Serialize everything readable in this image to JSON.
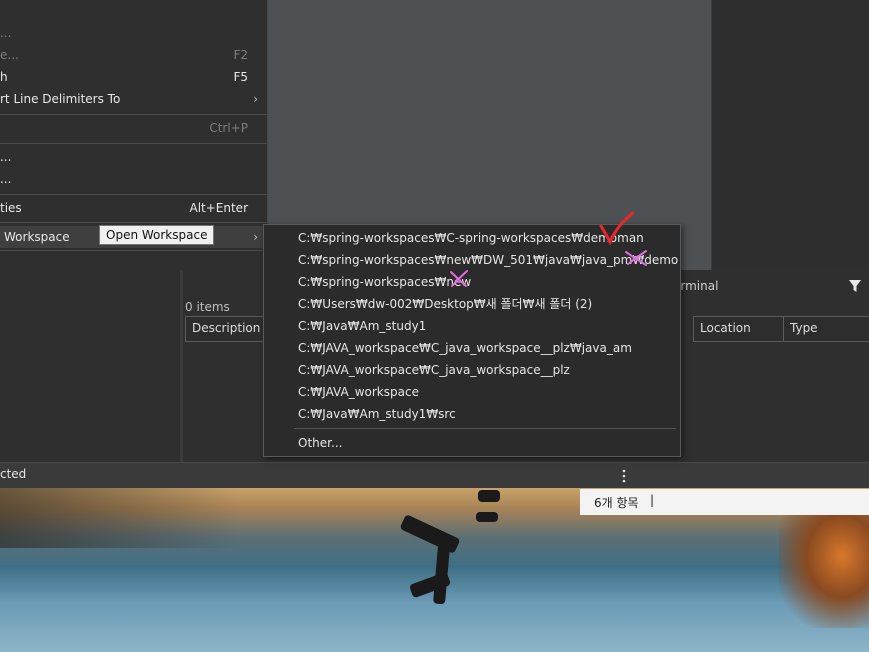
{
  "file_menu": {
    "items": [
      {
        "label": "...",
        "accelerator": "",
        "disabled": true
      },
      {
        "label": "e...",
        "accelerator": "F2",
        "disabled": true
      },
      {
        "label": "h",
        "accelerator": "F5",
        "disabled": false
      },
      {
        "label": "rt Line Delimiters To",
        "accelerator": "",
        "disabled": false
      },
      {
        "label": "",
        "accelerator": "Ctrl+P",
        "disabled": true
      },
      {
        "label": "...",
        "accelerator": "",
        "disabled": false
      },
      {
        "label": "...",
        "accelerator": "",
        "disabled": false
      },
      {
        "label": "ties",
        "accelerator": "Alt+Enter",
        "disabled": false
      },
      {
        "label": "Workspace",
        "accelerator": "",
        "disabled": false
      }
    ],
    "submenu_arrow": "›"
  },
  "tooltip": "Open Workspace",
  "workspace_submenu": {
    "items": [
      "C:₩spring-workspaces₩C-spring-workspaces₩demoman",
      "C:₩spring-workspaces₩new₩DW_501₩java₩java_pm₩demo",
      "C:₩spring-workspaces₩new",
      "C:₩Users₩dw-002₩Desktop₩새 폴더₩새 폴더 (2)",
      "C:₩Java₩Am_study1",
      "C:₩JAVA_workspace₩C_java_workspace__plz₩java_am",
      "C:₩JAVA_workspace₩C_java_workspace__plz",
      "C:₩JAVA_workspace",
      "C:₩Java₩Am_study1₩src"
    ],
    "other_label": "Other..."
  },
  "problems_view": {
    "tab_label": "erminal",
    "item_count": "0 items",
    "columns": [
      "Description",
      "Location",
      "Type"
    ],
    "filter_icon": "filter-icon"
  },
  "status_bar": {
    "left_text": "cted",
    "menu_icon": "more-vertical-icon"
  },
  "explorer_status": {
    "count_text": "6개 항목",
    "divider": "|"
  },
  "annotations": {
    "check_color": "#e8262a",
    "cross_color": "#e46be0"
  }
}
